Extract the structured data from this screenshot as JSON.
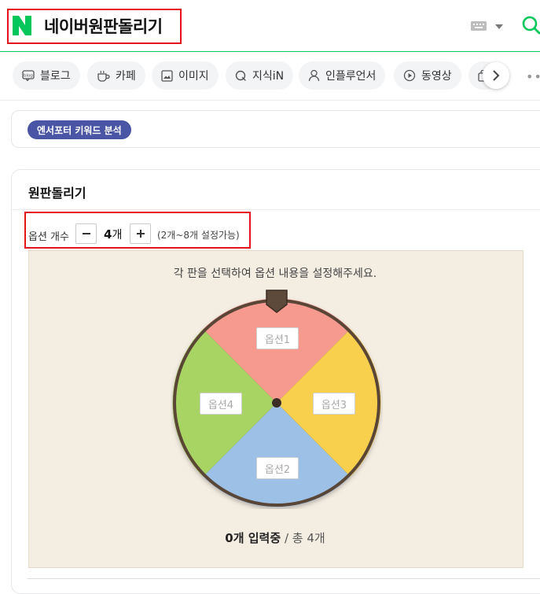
{
  "header": {
    "search_query": "네이버원판돌리기",
    "brand_color": "#03c75a",
    "icons": [
      "naver-logo",
      "keyboard-icon",
      "chevron-down-icon",
      "search-icon"
    ]
  },
  "tabs": [
    {
      "label": "블로그",
      "icon": "blog-icon"
    },
    {
      "label": "카페",
      "icon": "cafe-icon"
    },
    {
      "label": "이미지",
      "icon": "image-icon"
    },
    {
      "label": "지식iN",
      "icon": "kin-icon"
    },
    {
      "label": "인플루언서",
      "icon": "person-icon"
    },
    {
      "label": "동영상",
      "icon": "play-icon"
    }
  ],
  "keyword_pill": "엔서포터 키워드 분석",
  "roulette": {
    "title": "원판돌리기",
    "option_count_label": "옵션 개수",
    "option_count": "4",
    "option_count_unit": "개",
    "range_note": "(2개~8개 설정가능)",
    "instruction": "각 판을 선택하여 옵션 내용을 설정해주세요.",
    "segments": [
      {
        "label": "옵션1",
        "color": "#f6998f"
      },
      {
        "label": "옵션3",
        "color": "#f8d04e"
      },
      {
        "label": "옵션2",
        "color": "#9cc0e6"
      },
      {
        "label": "옵션4",
        "color": "#a8d463"
      }
    ],
    "status_count": "0개 입력중",
    "status_total": " / 총 4개"
  }
}
